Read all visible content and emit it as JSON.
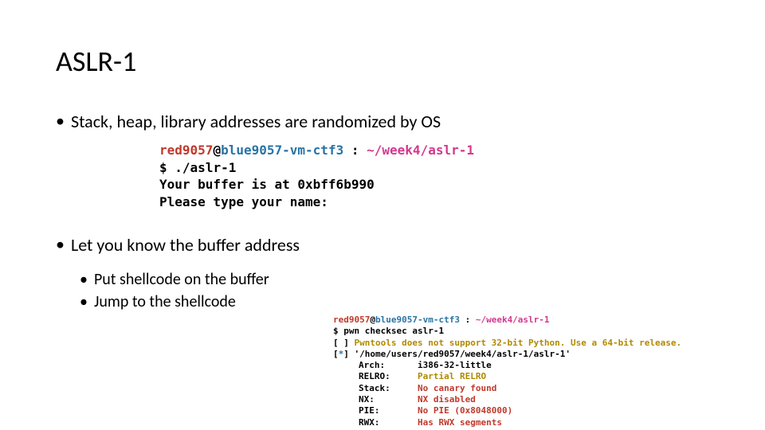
{
  "title": "ASLR-1",
  "bullets": {
    "b1": "Stack, heap, library addresses are randomized by OS",
    "b2": "Let you know the buffer address",
    "sub1": "Put shellcode on the buffer",
    "sub2": "Jump to the shellcode"
  },
  "term1": {
    "user": "red9057",
    "at": "@",
    "host": "blue9057-vm-ctf3",
    "colon": ":",
    "path": "~/week4/aslr-1",
    "prompt": "$",
    "cmd": "./aslr-1",
    "out1": "Your buffer is at 0xbff6b990",
    "out2": "Please type your name:"
  },
  "term2": {
    "user": "red9057",
    "at": "@",
    "host": "blue9057-vm-ctf3",
    "colon": ":",
    "path": "~/week4/aslr-1",
    "prompt": "$",
    "cmd": "pwn checksec aslr-1",
    "warn_open": "[ ]",
    "warn": "Pwntools does not support 32-bit Python.  Use a 64-bit release.",
    "star_open": "[",
    "star": "*",
    "star_close": "]",
    "file": "'/home/users/red9057/week4/aslr-1/aslr-1'",
    "arch_k": "Arch:",
    "arch_v": "i386-32-little",
    "relro_k": "RELRO:",
    "relro_v": "Partial RELRO",
    "stack_k": "Stack:",
    "stack_v": "No canary found",
    "nx_k": "NX:",
    "nx_v": "NX disabled",
    "pie_k": "PIE:",
    "pie_v": "No PIE (0x8048000)",
    "rwx_k": "RWX:",
    "rwx_v": "Has RWX segments"
  }
}
